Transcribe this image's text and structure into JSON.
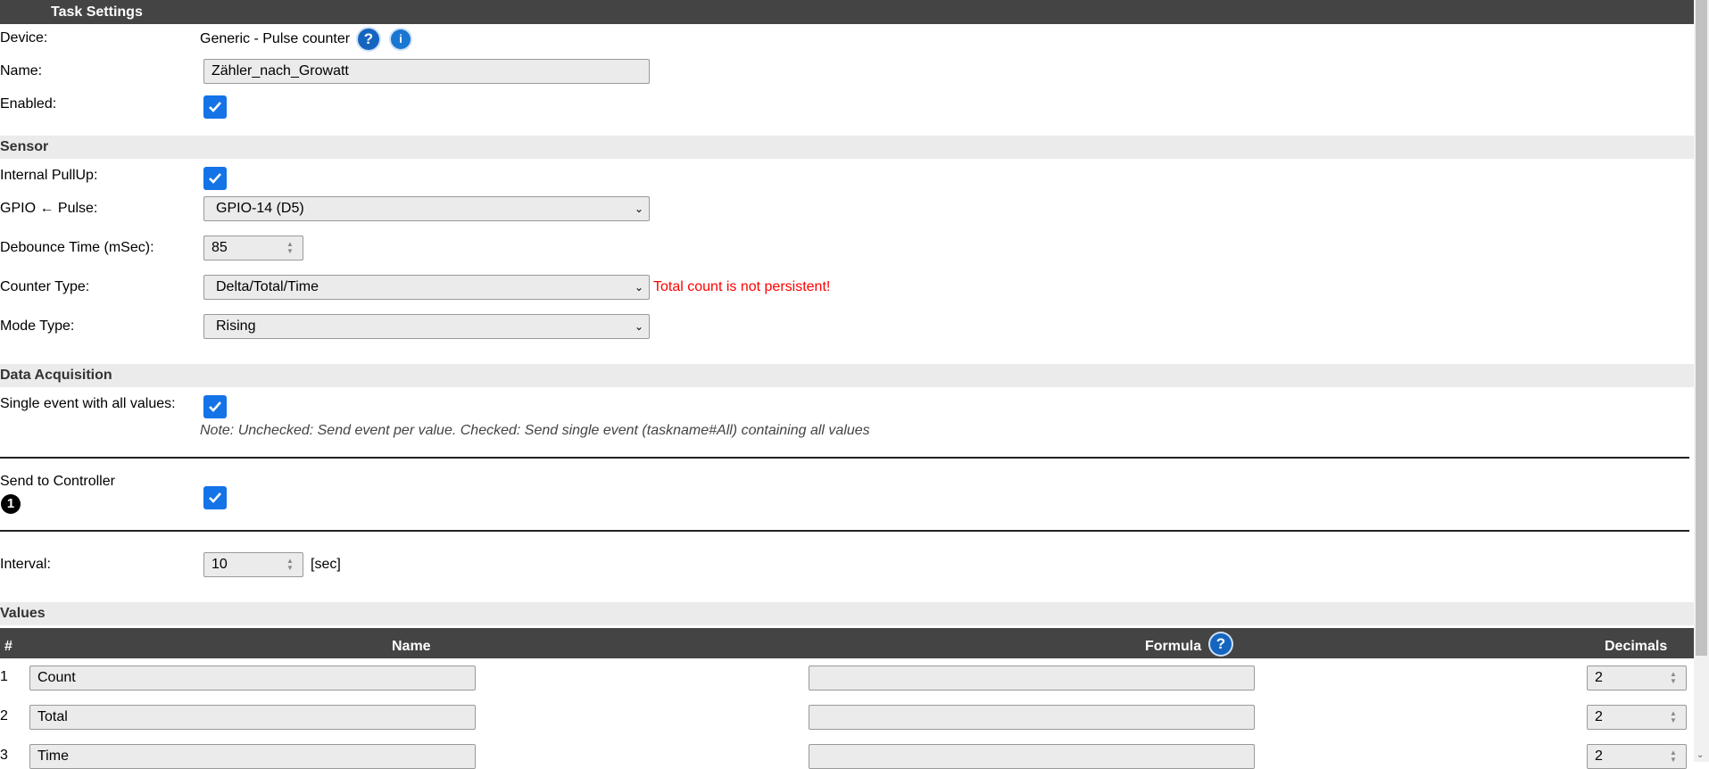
{
  "header": {
    "title": "Task Settings"
  },
  "device": {
    "label": "Device:",
    "value": "Generic - Pulse counter",
    "help": "?",
    "info": "i"
  },
  "name": {
    "label": "Name:",
    "value": "Zähler_nach_Growatt"
  },
  "enabled": {
    "label": "Enabled:",
    "checked": true
  },
  "sensor": {
    "title": "Sensor",
    "pullup_label": "Internal PullUp:",
    "gpio_label": "GPIO ← Pulse:",
    "gpio_value": "GPIO-14 (D5)",
    "debounce_label": "Debounce Time (mSec):",
    "debounce_value": "85",
    "counter_type_label": "Counter Type:",
    "counter_type_value": "Delta/Total/Time",
    "counter_warning": "Total count is not persistent!",
    "mode_type_label": "Mode Type:",
    "mode_type_value": "Rising"
  },
  "acquisition": {
    "title": "Data Acquisition",
    "single_event_label": "Single event with all values:",
    "note": "Note: Unchecked: Send event per value. Checked: Send single event (taskname#All) containing all values",
    "send_controller_label": "Send to Controller",
    "controller_number": "1",
    "interval_label": "Interval:",
    "interval_value": "10",
    "interval_unit": "[sec]"
  },
  "values": {
    "title": "Values",
    "headers": {
      "num": "#",
      "name": "Name",
      "formula": "Formula",
      "formula_help": "?",
      "decimals": "Decimals"
    },
    "rows": [
      {
        "num": "1",
        "name": "Count",
        "formula": "",
        "decimals": "2"
      },
      {
        "num": "2",
        "name": "Total",
        "formula": "",
        "decimals": "2"
      },
      {
        "num": "3",
        "name": "Time",
        "formula": "",
        "decimals": "2"
      }
    ]
  },
  "colors": {
    "header_bg": "#444444",
    "accent": "#1473e6",
    "warning": "#ff0000",
    "section_bg": "#ebebeb"
  }
}
